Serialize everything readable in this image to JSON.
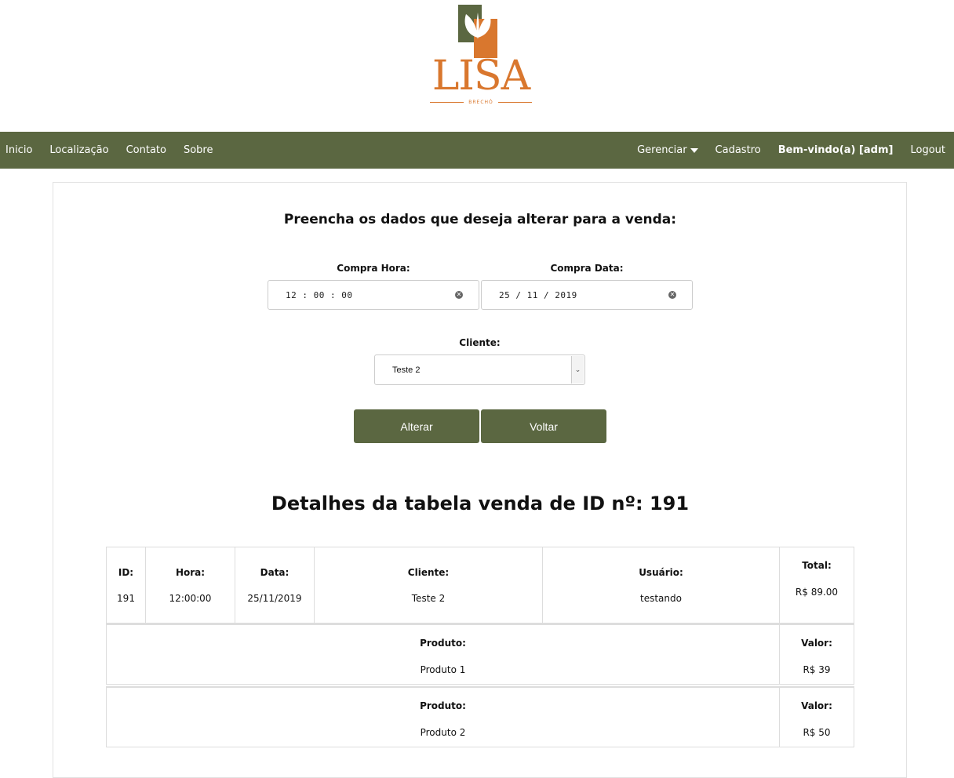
{
  "brand": {
    "name": "LISA",
    "tagline": "BRECHÓ"
  },
  "nav": {
    "left": [
      "Inicio",
      "Localização",
      "Contato",
      "Sobre"
    ],
    "manage": "Gerenciar",
    "register": "Cadastro",
    "welcome": "Bem-vindo(a) [adm]",
    "logout": "Logout"
  },
  "form": {
    "title": "Preencha os dados que deseja alterar para a venda:",
    "hora_label": "Compra Hora:",
    "hora_value": "12 : 00 : 00",
    "data_label": "Compra Data:",
    "data_value": "25 / 11 / 2019",
    "cliente_label": "Cliente:",
    "cliente_value": "Teste 2",
    "alterar": "Alterar",
    "voltar": "Voltar"
  },
  "details": {
    "title": "Detalhes da tabela venda de ID nº: 191",
    "headers": {
      "id": "ID:",
      "hora": "Hora:",
      "data": "Data:",
      "cliente": "Cliente:",
      "usuario": "Usuário:",
      "total": "Total:"
    },
    "values": {
      "id": "191",
      "hora": "12:00:00",
      "data": "25/11/2019",
      "cliente": "Teste 2",
      "usuario": "testando",
      "total": "R$ 89.00"
    },
    "products": [
      {
        "label": "Produto:",
        "name": "Produto 1",
        "value_label": "Valor:",
        "value": "R$ 39"
      },
      {
        "label": "Produto:",
        "name": "Produto 2",
        "value_label": "Valor:",
        "value": "R$ 50"
      }
    ]
  },
  "colors": {
    "brand_green": "#5b6741",
    "brand_orange": "#d9772e"
  }
}
